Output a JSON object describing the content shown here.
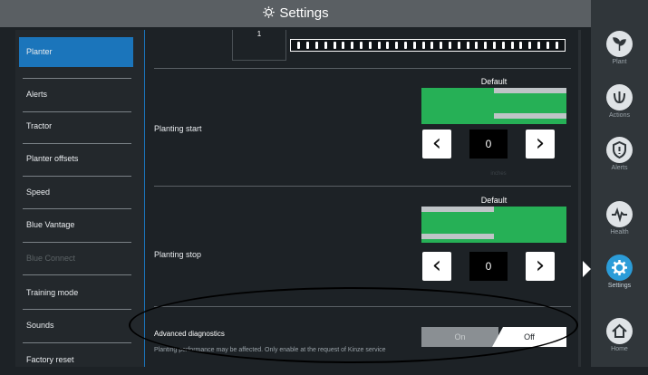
{
  "header": {
    "title": "Settings",
    "icon": "gear-icon"
  },
  "sidebar": {
    "items": [
      {
        "label": "Planter",
        "state": "active"
      },
      {
        "label": "Alerts",
        "state": "normal"
      },
      {
        "label": "Tractor",
        "state": "normal"
      },
      {
        "label": "Planter offsets",
        "state": "normal"
      },
      {
        "label": "Speed",
        "state": "normal"
      },
      {
        "label": "Blue Vantage",
        "state": "normal"
      },
      {
        "label": "Blue Connect",
        "state": "disabled"
      },
      {
        "label": "Training mode",
        "state": "normal"
      },
      {
        "label": "Sounds",
        "state": "normal"
      },
      {
        "label": "Factory reset",
        "state": "normal"
      }
    ]
  },
  "main": {
    "top_cell_value": "1",
    "planting_start": {
      "label": "Planting start",
      "default_label": "Default",
      "value": "0",
      "sub": "inches"
    },
    "planting_stop": {
      "label": "Planting stop",
      "default_label": "Default",
      "value": "0"
    },
    "diagnostics": {
      "label": "Advanced diagnostics",
      "description": "Planting performance may be affected. Only enable at the request of Kinze service",
      "on_label": "On",
      "off_label": "Off",
      "selected": "Off"
    }
  },
  "rightnav": {
    "items": [
      {
        "label": "Plant",
        "icon": "plant-icon"
      },
      {
        "label": "Actions",
        "icon": "actions-icon"
      },
      {
        "label": "Alerts",
        "icon": "alert-shield-icon"
      },
      {
        "label": "Health",
        "icon": "health-icon"
      },
      {
        "label": "Settings",
        "icon": "gear-icon",
        "active": true
      },
      {
        "label": "Home",
        "icon": "home-icon"
      }
    ]
  },
  "colors": {
    "accent": "#1b75bb",
    "green": "#26b056",
    "active_nav": "#2b9cd8"
  }
}
